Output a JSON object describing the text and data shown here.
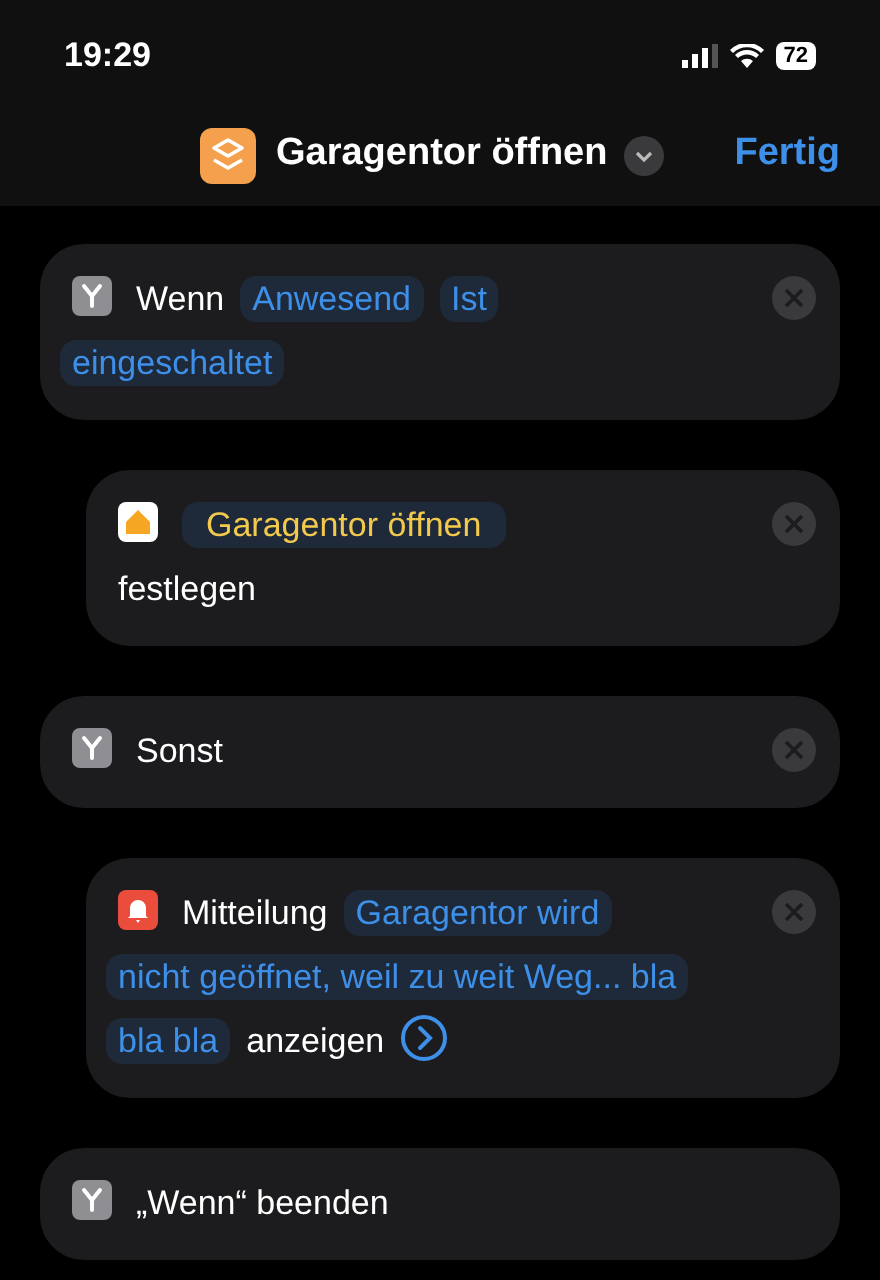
{
  "status_bar": {
    "time": "19:29",
    "battery": "72"
  },
  "header": {
    "title": "Garagentor öffnen",
    "done": "Fertig"
  },
  "actions": [
    {
      "kind": "if",
      "indented": false,
      "removable": true,
      "expandable": false,
      "parts": [
        {
          "kind": "label",
          "text": "Wenn"
        },
        {
          "kind": "variable",
          "text": "Anwesend"
        },
        {
          "kind": "variable",
          "lines": [
            "Ist",
            "eingeschaltet"
          ]
        }
      ]
    },
    {
      "kind": "home",
      "indented": true,
      "removable": true,
      "expandable": false,
      "parts": [
        {
          "kind": "scene",
          "text": "Garagentor öffnen"
        },
        {
          "kind": "label",
          "text": "festlegen"
        }
      ]
    },
    {
      "kind": "otherwise",
      "indented": false,
      "removable": true,
      "expandable": false,
      "parts": [
        {
          "kind": "label",
          "text": "Sonst"
        }
      ]
    },
    {
      "kind": "notification",
      "indented": true,
      "removable": true,
      "expandable": true,
      "parts": [
        {
          "kind": "label",
          "text": "Mitteilung"
        },
        {
          "kind": "variable",
          "lines": [
            "Garagentor wird",
            "nicht geöffnet, weil zu weit Weg... bla",
            "bla bla"
          ]
        },
        {
          "kind": "label",
          "text": "anzeigen"
        }
      ]
    },
    {
      "kind": "end",
      "indented": false,
      "removable": false,
      "expandable": false,
      "parts": [
        {
          "kind": "label",
          "text": "„Wenn“ beenden"
        }
      ]
    }
  ]
}
